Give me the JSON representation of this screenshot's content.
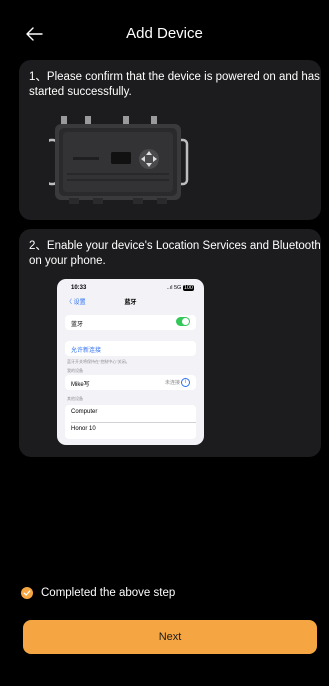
{
  "header": {
    "title": "Add Device",
    "back_icon": "arrow-left-icon"
  },
  "steps": [
    {
      "text": "1、Please confirm that the device is powered on and has started successfully."
    },
    {
      "text": "2、Enable your device's Location Services and Bluetooth on your phone."
    }
  ],
  "phone_screen": {
    "time": "10:33",
    "signal": "..ıl 5G",
    "battery": "100",
    "back_label": "〈 设置",
    "nav_title": "蓝牙",
    "bluetooth_label": "蓝牙",
    "allow_new_connections": "允许新连接",
    "hint": "蓝牙开关将保持在“控制中心”关闭。",
    "my_devices_header": "我的设备",
    "my_device_name": "Mike写",
    "my_device_status": "未连接",
    "other_devices_header": "其他设备",
    "other_devices": [
      "Computer",
      "Honor 10"
    ]
  },
  "footer": {
    "completed_label": "Completed the above step",
    "completed_checked": true,
    "next_label": "Next"
  },
  "colors": {
    "background": "#000000",
    "card": "#1c1c1e",
    "accent": "#f5a643"
  }
}
